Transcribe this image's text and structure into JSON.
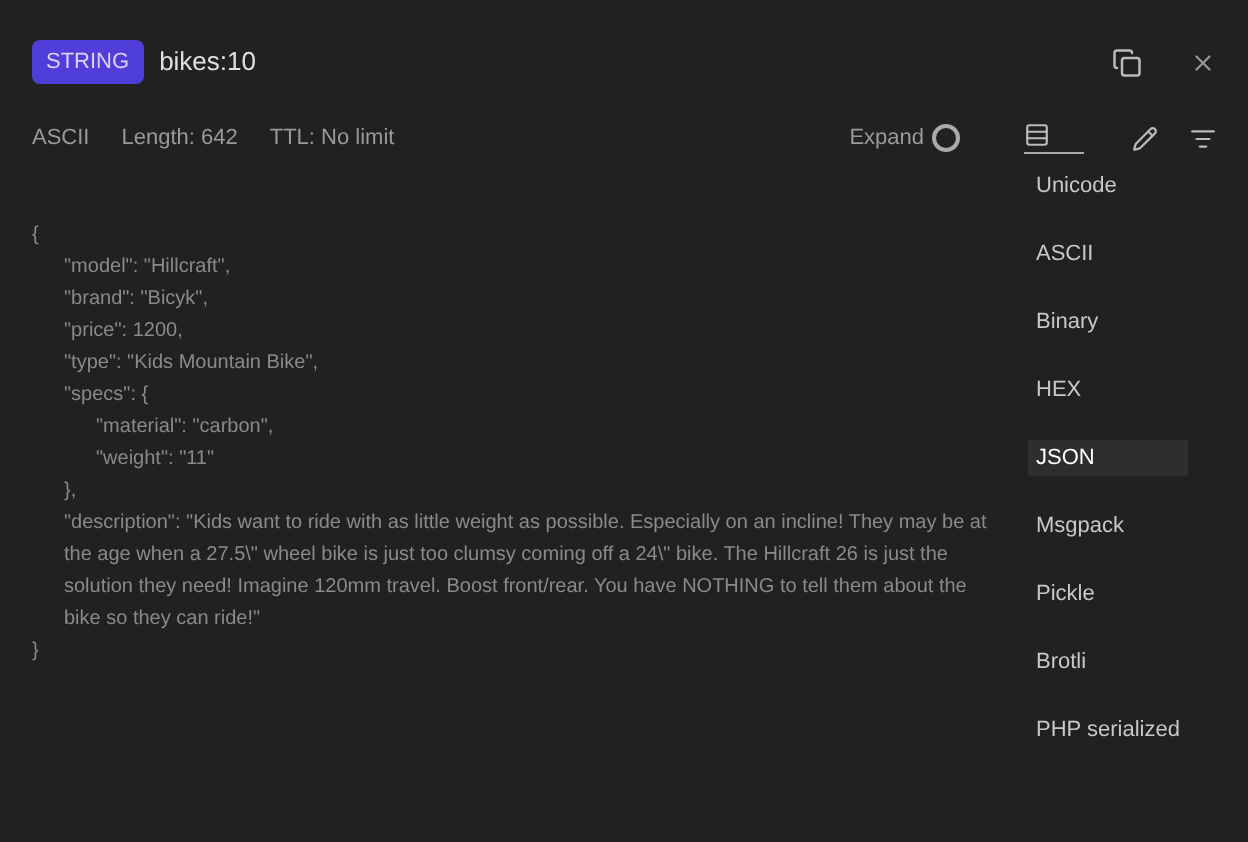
{
  "header": {
    "type_badge": "STRING",
    "key": "bikes:10"
  },
  "toolbar": {
    "encoding": "ASCII",
    "length": "Length: 642",
    "ttl": "TTL: No limit",
    "expand": {
      "label": "Expand",
      "on": false
    }
  },
  "value_lines": [
    {
      "text": "{",
      "children": [
        {
          "text": "\"model\": \"Hillcraft\","
        },
        {
          "text": "\"brand\": \"Bicyk\","
        },
        {
          "text": "\"price\": 1200,"
        },
        {
          "text": "\"type\": \"Kids Mountain Bike\","
        },
        {
          "text": "\"specs\": {",
          "children": [
            {
              "text": "\"material\": \"carbon\","
            },
            {
              "text": "\"weight\": \"11\""
            }
          ]
        },
        {
          "text": "},"
        },
        {
          "text": "\"description\": \"Kids want to ride with as little weight as possible. Especially on an incline! They may be at the age when a 27.5\\\" wheel bike is just too clumsy coming off a 24\\\" bike. The Hillcraft 26 is just the solution they need! Imagine 120mm travel. Boost front/rear. You have NOTHING to tell them about the bike so they can ride!\""
        }
      ]
    },
    {
      "text": "}"
    }
  ],
  "format_menu": [
    {
      "label": "Unicode",
      "selected": false
    },
    {
      "label": "ASCII",
      "selected": false
    },
    {
      "label": "Binary",
      "selected": false
    },
    {
      "label": "HEX",
      "selected": false
    },
    {
      "label": "JSON",
      "selected": true
    },
    {
      "label": "Msgpack",
      "selected": false
    },
    {
      "label": "Pickle",
      "selected": false
    },
    {
      "label": "Brotli",
      "selected": false
    },
    {
      "label": "PHP serialized",
      "selected": false
    }
  ]
}
